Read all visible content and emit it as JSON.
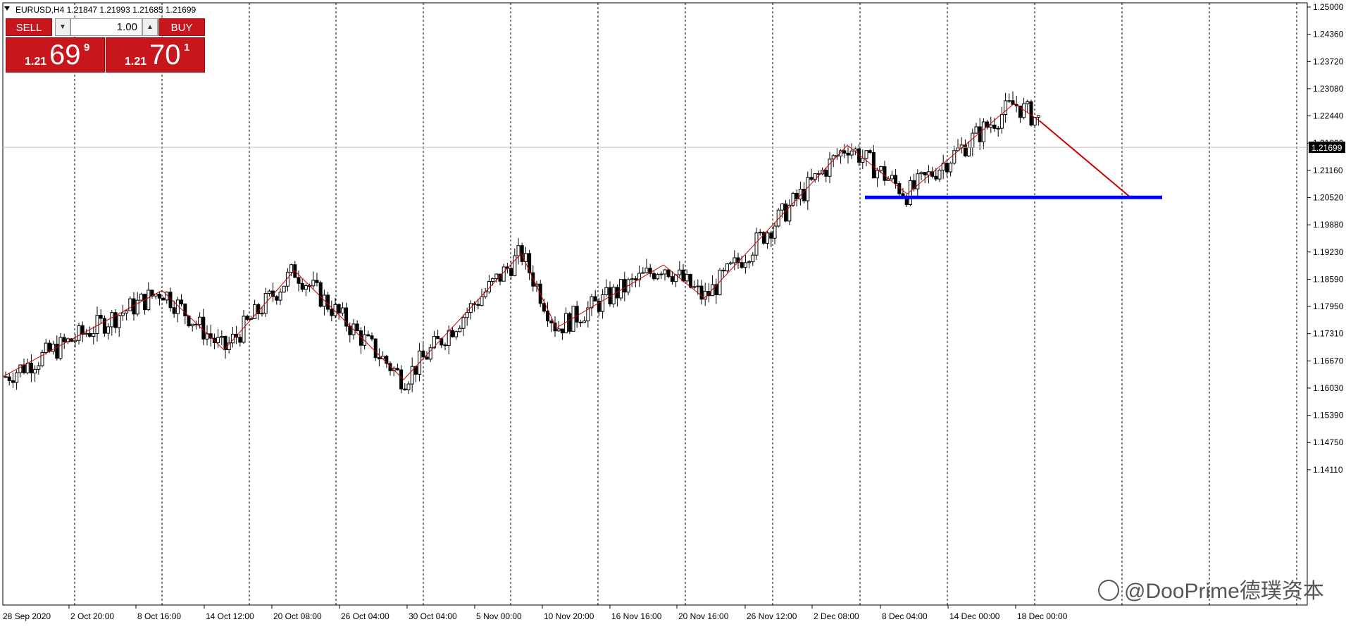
{
  "symbol_header": "EURUSD,H4  1.21847 1.21993 1.21685 1.21699",
  "trade_panel": {
    "sell_label": "SELL",
    "buy_label": "BUY",
    "lot_value": "1.00",
    "sell_price_small": "1.21",
    "sell_price_big": "69",
    "sell_price_sup": "9",
    "buy_price_small": "1.21",
    "buy_price_big": "70",
    "buy_price_sup": "1"
  },
  "watermark": "@DooPrime德璞资本",
  "colors": {
    "bull_candle": "#ffffff",
    "bear_candle": "#000000",
    "zigzag": "#cc0000",
    "support_line": "#0000ff",
    "panel_red": "#c8161d",
    "grid": "#000000"
  },
  "chart_data": {
    "type": "candlestick",
    "symbol": "EURUSD",
    "timeframe": "H4",
    "ohlc_header": {
      "open": 1.21847,
      "high": 1.21993,
      "low": 1.21685,
      "close": 1.21699
    },
    "current_price": "1.21699",
    "y_ticks": [
      "1.25000",
      "1.24360",
      "1.23720",
      "1.23080",
      "1.22440",
      "1.21800",
      "1.21160",
      "1.20520",
      "1.19880",
      "1.19230",
      "1.18590",
      "1.17950",
      "1.17310",
      "1.16670",
      "1.16030",
      "1.15390",
      "1.14750",
      "1.14110"
    ],
    "ylim": [
      1.1411,
      1.25
    ],
    "x_ticks": [
      "28 Sep 2020",
      "2 Oct 20:00",
      "8 Oct 16:00",
      "14 Oct 12:00",
      "20 Oct 08:00",
      "26 Oct 04:00",
      "30 Oct 04:00",
      "5 Nov 00:00",
      "10 Nov 20:00",
      "16 Nov 16:00",
      "20 Nov 16:00",
      "26 Nov 12:00",
      "2 Dec 08:00",
      "8 Dec 04:00",
      "14 Dec 00:00",
      "18 Dec 00:00"
    ],
    "grid": "vertical dotted",
    "zigzag_pivots": [
      {
        "date": "28 Sep 2020",
        "price": 1.163
      },
      {
        "date": "8 Oct",
        "price": 1.1833
      },
      {
        "date": "14 Oct",
        "price": 1.1693
      },
      {
        "date": "21 Oct",
        "price": 1.188
      },
      {
        "date": "29 Oct",
        "price": 1.1623
      },
      {
        "date": "5 Nov",
        "price": 1.192
      },
      {
        "date": "11 Nov",
        "price": 1.1745
      },
      {
        "date": "16 Nov",
        "price": 1.1893
      },
      {
        "date": "19 Nov",
        "price": 1.1815
      },
      {
        "date": "4 Dec",
        "price": 1.2175
      },
      {
        "date": "9 Dec",
        "price": 1.206
      },
      {
        "date": "17 Dec",
        "price": 1.2273
      },
      {
        "date": "18 Dec",
        "price": 1.2232
      },
      {
        "date": "projection",
        "price": 1.2052
      }
    ],
    "support_level": 1.2052
  }
}
